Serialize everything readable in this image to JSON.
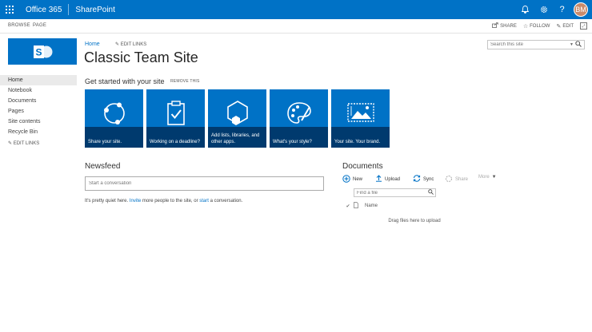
{
  "suite_bar": {
    "brand": "Office 365",
    "app": "SharePoint",
    "user_initials": "BM",
    "icons": [
      "app-launcher-icon",
      "bell-icon",
      "gear-icon",
      "help-icon"
    ]
  },
  "ribbon": {
    "tabs": [
      "BROWSE",
      "PAGE"
    ],
    "actions": [
      {
        "label": "SHARE",
        "icon": "share-icon"
      },
      {
        "label": "FOLLOW",
        "icon": "star-icon"
      },
      {
        "label": "EDIT",
        "icon": "pencil-icon"
      }
    ]
  },
  "search": {
    "placeholder": "Search this site"
  },
  "breadcrumb": {
    "home": "Home",
    "edit_links": "EDIT LINKS"
  },
  "site_title": "Classic Team Site",
  "left_nav": {
    "items": [
      "Home",
      "Notebook",
      "Documents",
      "Pages",
      "Site contents",
      "Recycle Bin"
    ],
    "selected": "Home",
    "edit_links": "EDIT LINKS"
  },
  "get_started": {
    "title": "Get started with your site",
    "remove": "REMOVE THIS",
    "tiles": [
      {
        "label": "Share your site.",
        "icon": "share-network-icon"
      },
      {
        "label": "Working on a deadline?",
        "icon": "clipboard-check-icon"
      },
      {
        "label": "Add lists, libraries, and other apps.",
        "icon": "hexagon-plus-icon"
      },
      {
        "label": "What's your style?",
        "icon": "palette-icon"
      },
      {
        "label": "Your site. Your brand.",
        "icon": "picture-icon"
      }
    ]
  },
  "newsfeed": {
    "title": "Newsfeed",
    "placeholder": "Start a conversation",
    "quiet_prefix": "It's pretty quiet here.",
    "invite": "Invite",
    "quiet_middle": "more people to the site, or",
    "start": "start",
    "quiet_suffix": "a conversation."
  },
  "documents": {
    "title": "Documents",
    "commands": [
      {
        "label": "New",
        "icon": "plus-circle-icon",
        "enabled": true
      },
      {
        "label": "Upload",
        "icon": "upload-icon",
        "enabled": true
      },
      {
        "label": "Sync",
        "icon": "sync-icon",
        "enabled": true
      },
      {
        "label": "Share",
        "icon": "share-icon",
        "enabled": false
      },
      {
        "label": "More",
        "icon": "chevron-down-icon",
        "enabled": false
      }
    ],
    "find_placeholder": "Find a file",
    "column_name": "Name",
    "drag_text": "Drag files here to upload"
  },
  "colors": {
    "brand_blue": "#0072c6",
    "tile_band": "#003a6e"
  }
}
